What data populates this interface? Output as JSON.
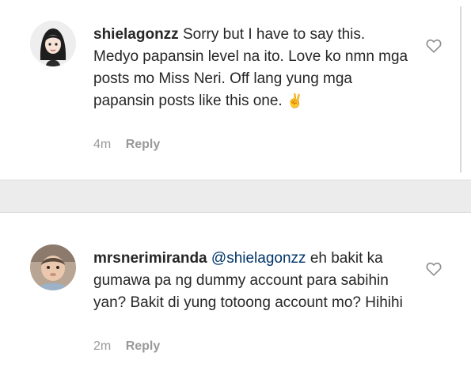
{
  "comments": [
    {
      "username": "shielagonzz",
      "text": " Sorry but I have to say this. Medyo papansin level na ito. Love ko nmn mga posts mo Miss Neri. Off lang yung mga papansin posts like this one. ",
      "emoji": "✌",
      "time": "4m",
      "reply_label": "Reply",
      "avatar_icon": "cartoon-girl-avatar-icon",
      "like_icon": "heart-outline-icon"
    },
    {
      "username": "mrsnerimiranda",
      "mention": "@shielagonzz",
      "text": " eh bakit ka gumawa pa ng dummy account para sabihin yan? Bakit di yung totoong account mo? Hihihi",
      "time": "2m",
      "reply_label": "Reply",
      "avatar_icon": "baby-photo-avatar-icon",
      "like_icon": "heart-outline-icon"
    }
  ]
}
